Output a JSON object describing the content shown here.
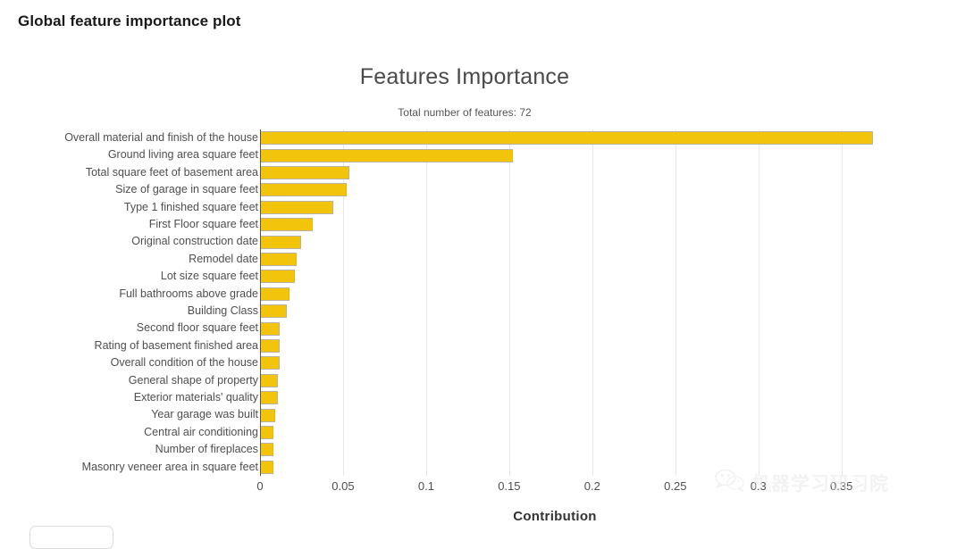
{
  "page": {
    "header_title": "Global feature importance plot"
  },
  "watermark": {
    "icon": "wechat-icon",
    "text": "机器学习研习院"
  },
  "bottom_control": {
    "name": "rounded-control",
    "label": ""
  },
  "chart_data": {
    "type": "bar",
    "orientation": "horizontal",
    "title": "Features Importance",
    "subtitle": "Total number of features: 72",
    "xlabel": "Contribution",
    "ylabel": "",
    "xlim": [
      0,
      0.355
    ],
    "xticks": [
      0,
      0.05,
      0.1,
      0.15,
      0.2,
      0.25,
      0.3,
      0.35
    ],
    "xtick_labels": [
      "0",
      "0.05",
      "0.1",
      "0.15",
      "0.2",
      "0.25",
      "0.3",
      "0.35"
    ],
    "grid": true,
    "legend": false,
    "bar_color": "#f2c40c",
    "bar_border_color": "#b9b2a0",
    "axis_color": "#555555",
    "gridline_color": "#e6e6e6",
    "categories": [
      "Overall material and finish of the house",
      "Ground living area square feet",
      "Total square feet of basement area",
      "Size of garage in square feet",
      "Type 1 finished square feet",
      "First Floor square feet",
      "Original construction date",
      "Remodel date",
      "Lot size square feet",
      "Full bathrooms above grade",
      "Building Class",
      "Second floor square feet",
      "Rating of basement finished area",
      "Overall condition of the house",
      "General shape of property",
      "Exterior materials' quality",
      "Year garage was built",
      "Central air conditioning",
      "Number of fireplaces",
      "Masonry veneer area in square feet"
    ],
    "values": [
      0.369,
      0.152,
      0.054,
      0.052,
      0.044,
      0.032,
      0.025,
      0.022,
      0.021,
      0.018,
      0.016,
      0.012,
      0.012,
      0.012,
      0.011,
      0.011,
      0.009,
      0.008,
      0.008,
      0.008
    ]
  }
}
